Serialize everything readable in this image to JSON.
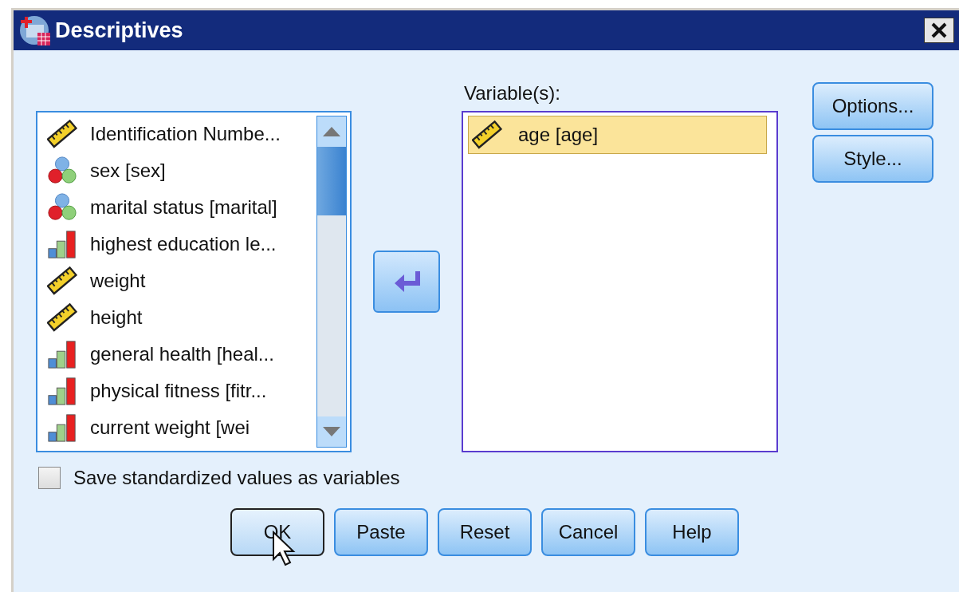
{
  "window": {
    "title": "Descriptives"
  },
  "source_list": {
    "items": [
      {
        "label": "Identification Numbe...",
        "kind": "scale",
        "selected": false
      },
      {
        "label": "sex [sex]",
        "kind": "nominal",
        "selected": false
      },
      {
        "label": "marital status [marital]",
        "kind": "nominal",
        "selected": false
      },
      {
        "label": "highest education le...",
        "kind": "ordinal",
        "selected": false
      },
      {
        "label": "weight",
        "kind": "scale",
        "selected": false
      },
      {
        "label": "height",
        "kind": "scale",
        "selected": false
      },
      {
        "label": "general health [heal...",
        "kind": "ordinal",
        "selected": false
      },
      {
        "label": "physical fitness [fitr...",
        "kind": "ordinal",
        "selected": false
      },
      {
        "label": "current weight [wei",
        "kind": "ordinal",
        "selected": false
      }
    ]
  },
  "target": {
    "label": "Variable(s):",
    "items": [
      {
        "label": "age [age]",
        "kind": "scale",
        "selected": true
      }
    ]
  },
  "side_buttons": [
    "Options...",
    "Style..."
  ],
  "save_checkbox": {
    "label": "Save standardized values as variables",
    "checked": false
  },
  "buttons": [
    {
      "label": "OK",
      "default": true
    },
    {
      "label": "Paste",
      "default": false
    },
    {
      "label": "Reset",
      "default": false
    },
    {
      "label": "Cancel",
      "default": false
    },
    {
      "label": "Help",
      "default": false
    }
  ]
}
